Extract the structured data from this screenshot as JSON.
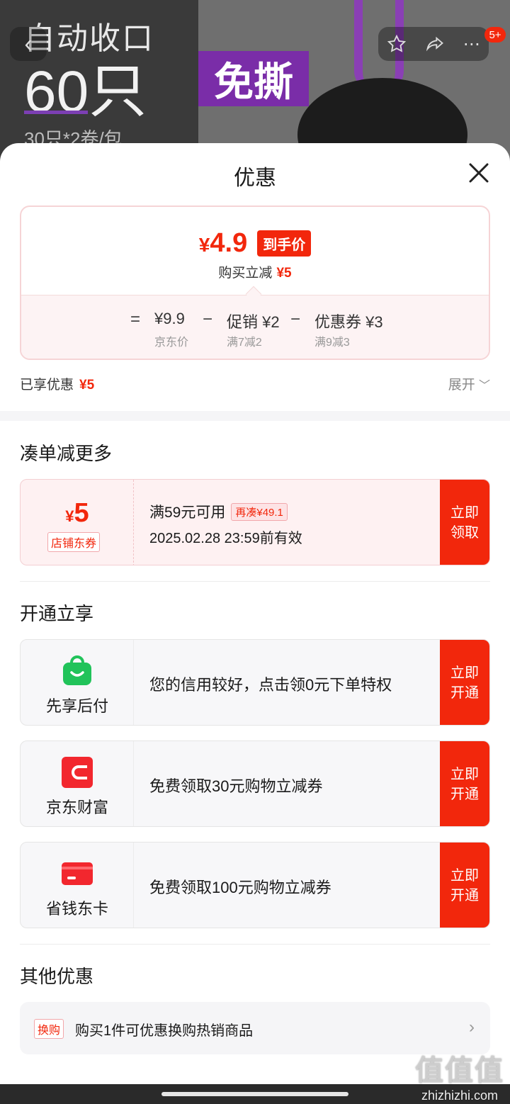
{
  "hero": {
    "line1": "自动收口",
    "line2": "60只",
    "line3": "30只*2卷/包",
    "tag": "免撕",
    "badge": "5+"
  },
  "sheet": {
    "title": "优惠"
  },
  "price_card": {
    "currency": "¥",
    "final_price": "4.9",
    "final_label": "到手价",
    "reduce_label": "购买立减",
    "reduce_value": "¥5",
    "formula": {
      "eq": "=",
      "base_value": "¥9.9",
      "base_label": "京东价",
      "minus1": "−",
      "promo_value": "促销 ¥2",
      "promo_label": "满7减2",
      "minus2": "−",
      "coupon_value": "优惠券 ¥3",
      "coupon_label": "满9减3"
    }
  },
  "enjoyed": {
    "label": "已享优惠",
    "value": "¥5",
    "expand": "展开"
  },
  "sections": {
    "more": "凑单减更多",
    "open": "开通立享",
    "other": "其他优惠"
  },
  "coupon": {
    "currency": "¥",
    "amount": "5",
    "type": "店铺东券",
    "condition": "满59元可用",
    "extra": "再凑¥49.1",
    "expiry": "2025.02.28 23:59前有效",
    "button_l1": "立即",
    "button_l2": "领取"
  },
  "services": [
    {
      "name": "先享后付",
      "desc": "您的信用较好，点击领0元下单特权",
      "button_l1": "立即",
      "button_l2": "开通",
      "icon": "shopping-bag-icon",
      "color": "#21c35a"
    },
    {
      "name": "京东财富",
      "desc": "免费领取30元购物立减券",
      "button_l1": "立即",
      "button_l2": "开通",
      "icon": "jd-finance-icon",
      "color": "#f2272e"
    },
    {
      "name": "省钱东卡",
      "desc": "免费领取100元购物立减券",
      "button_l1": "立即",
      "button_l2": "开通",
      "icon": "card-icon",
      "color": "#f2272e"
    }
  ],
  "other": {
    "tag": "换购",
    "text": "购买1件可优惠换购热销商品"
  },
  "watermark": {
    "logo": "值值值",
    "url": "zhizhizhi.com"
  },
  "colors": {
    "accent": "#f2270c",
    "coupon_bg": "#fef1f2",
    "service_bg": "#f7f7f9"
  }
}
